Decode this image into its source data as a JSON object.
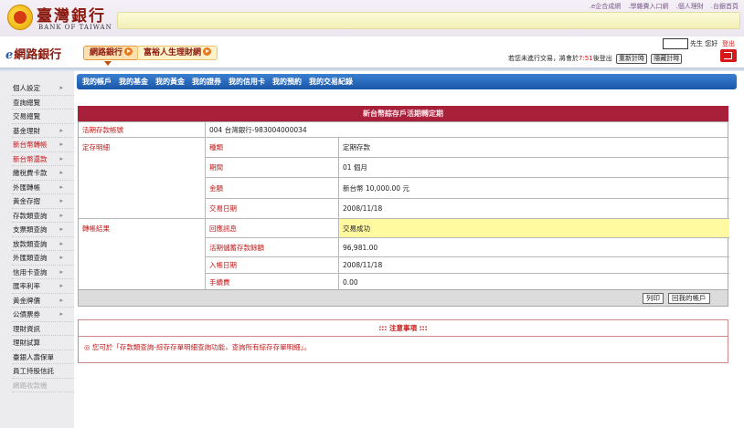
{
  "header": {
    "logo_cn": "臺灣銀行",
    "logo_en": "BANK OF TAIWAN",
    "top_links": [
      ".e企合成網",
      ".學雜費入口網",
      ".個人理財",
      ".台銀首頁"
    ]
  },
  "subheader": {
    "netbank_label": "網路銀行",
    "tab_active": "網路銀行",
    "tab_other": "富裕人生理財網",
    "greeting": "先生 您好",
    "logout": "登出",
    "session_prefix": "若您未進行交易，將會於",
    "session_time": "7:51",
    "session_suffix": "後登出",
    "renew_button": "重新計時",
    "hide_button": "隱藏計時"
  },
  "sidebar": {
    "items": [
      {
        "label": "個人設定",
        "arrow": "▸"
      },
      {
        "label": "查詢總覽",
        "arrow": ""
      },
      {
        "label": "交易總覽",
        "arrow": ""
      },
      {
        "label": "基金理財",
        "arrow": "▸"
      },
      {
        "label": "新台幣轉帳",
        "arrow": "▸"
      },
      {
        "label": "新台幣還款",
        "arrow": "▸"
      },
      {
        "label": "繳稅費卡款",
        "arrow": "▸"
      },
      {
        "label": "外匯轉帳",
        "arrow": "▸"
      },
      {
        "label": "黃金存摺",
        "arrow": "▸"
      },
      {
        "label": "存款類查詢",
        "arrow": "▸"
      },
      {
        "label": "支票類查詢",
        "arrow": "▸"
      },
      {
        "label": "放款類查詢",
        "arrow": "▸"
      },
      {
        "label": "外匯類查詢",
        "arrow": "▸"
      },
      {
        "label": "信用卡查詢",
        "arrow": "▸"
      },
      {
        "label": "匯率利率",
        "arrow": "▸"
      },
      {
        "label": "黃金牌價",
        "arrow": "▸"
      },
      {
        "label": "公債票券",
        "arrow": "▸"
      },
      {
        "label": "理財資訊",
        "arrow": ""
      },
      {
        "label": "理財試算",
        "arrow": ""
      },
      {
        "label": "臺銀人壽保單",
        "arrow": ""
      },
      {
        "label": "員工持股信託",
        "arrow": ""
      },
      {
        "label": "網路收款機",
        "arrow": ""
      }
    ]
  },
  "nav": {
    "items": [
      "我的帳戶",
      "我的基金",
      "我的黃金",
      "我的證券",
      "我的信用卡",
      "我的預約",
      "我的交易紀錄"
    ]
  },
  "transfer": {
    "title": "新台幣綜存戶活期轉定期",
    "account_label": "活期存款帳號",
    "account_value": "004 台灣銀行-983004000034",
    "detail_section": "定存明細",
    "type_label": "種類",
    "type_value": "定期存款",
    "period_label": "期間",
    "period_value": "01 個月",
    "amount_label": "金額",
    "amount_value": "新台幣 10,000.00 元",
    "date_label": "交易日期",
    "date_value": "2008/11/18",
    "result_section": "轉帳結果",
    "reply_label": "回應訊息",
    "reply_value": "交易成功",
    "balance_label": "活期儲蓄存款餘額",
    "balance_value": "96,981.00",
    "entry_date_label": "入帳日期",
    "entry_date_value": "2008/11/18",
    "fee_label": "手續費",
    "fee_value": "0.00",
    "print_button": "列印",
    "back_button": "回我的帳戶"
  },
  "notice": {
    "title": "::: 注意事項 :::",
    "text": "◎ 您可於「存款類查詢-綜存存單明細查詢功能，查詢所有綜存存單明細」。"
  },
  "colors": {
    "title_bar": "#a8203a",
    "highlight": "#fff9a0",
    "nav_blue": "#1a56a8"
  }
}
